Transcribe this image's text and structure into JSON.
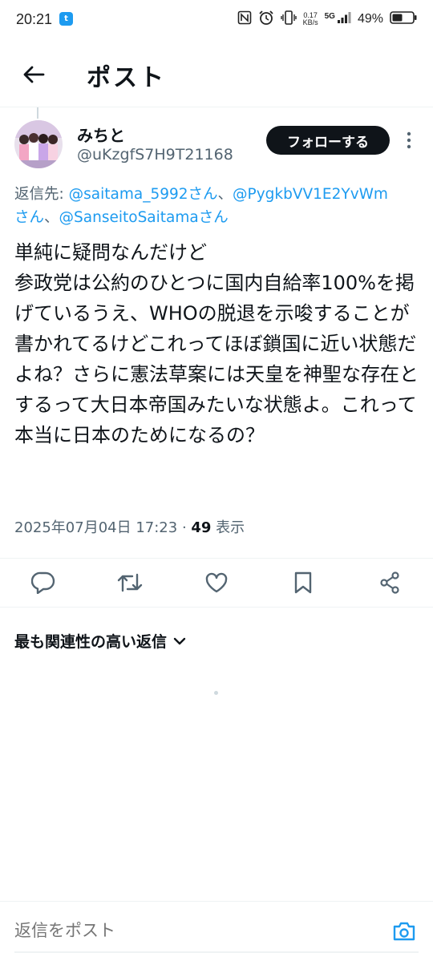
{
  "status_bar": {
    "time": "20:21",
    "app_badge": "t",
    "net_speed_value": "0.17",
    "net_speed_unit": "KB/s",
    "network": "5G",
    "battery": "49%"
  },
  "header": {
    "title": "ポスト",
    "back_icon": "arrow-left-icon"
  },
  "post": {
    "display_name": "みちと",
    "handle": "@uKzgfS7H9T21168",
    "follow_label": "フォローする",
    "reply_to_prefix": "返信先: ",
    "mention_1": "@saitama_5992さん",
    "sep_1": "、",
    "mention_2": "@PygkbVV1E2YvWm",
    "mention_2_suffix": "さん",
    "sep_2": "、",
    "mention_3": "@SanseitoSaitamaさん",
    "text": "単純に疑問なんだけど\n参政党は公約のひとつに国内自給率100%を掲げているうえ、WHOの脱退を示唆することが書かれてるけどこれってほぼ鎖国に近い状態だよね？さらに憲法草案には天皇を神聖な存在とするって大日本帝国みたいな状態よ。これって本当に日本のためになるの？",
    "timestamp": "2025年07月04日 17:23",
    "separator": " · ",
    "view_count": "49",
    "views_label": " 表示"
  },
  "actions": [
    "reply-icon",
    "retweet-icon",
    "like-icon",
    "bookmark-icon",
    "share-icon"
  ],
  "replies": {
    "sort_label": "最も関連性の高い返信"
  },
  "composer": {
    "placeholder": "返信をポスト"
  },
  "colors": {
    "accent": "#1d9bf0",
    "text": "#0f1419",
    "secondary": "#536471",
    "divider": "#eff3f4"
  }
}
